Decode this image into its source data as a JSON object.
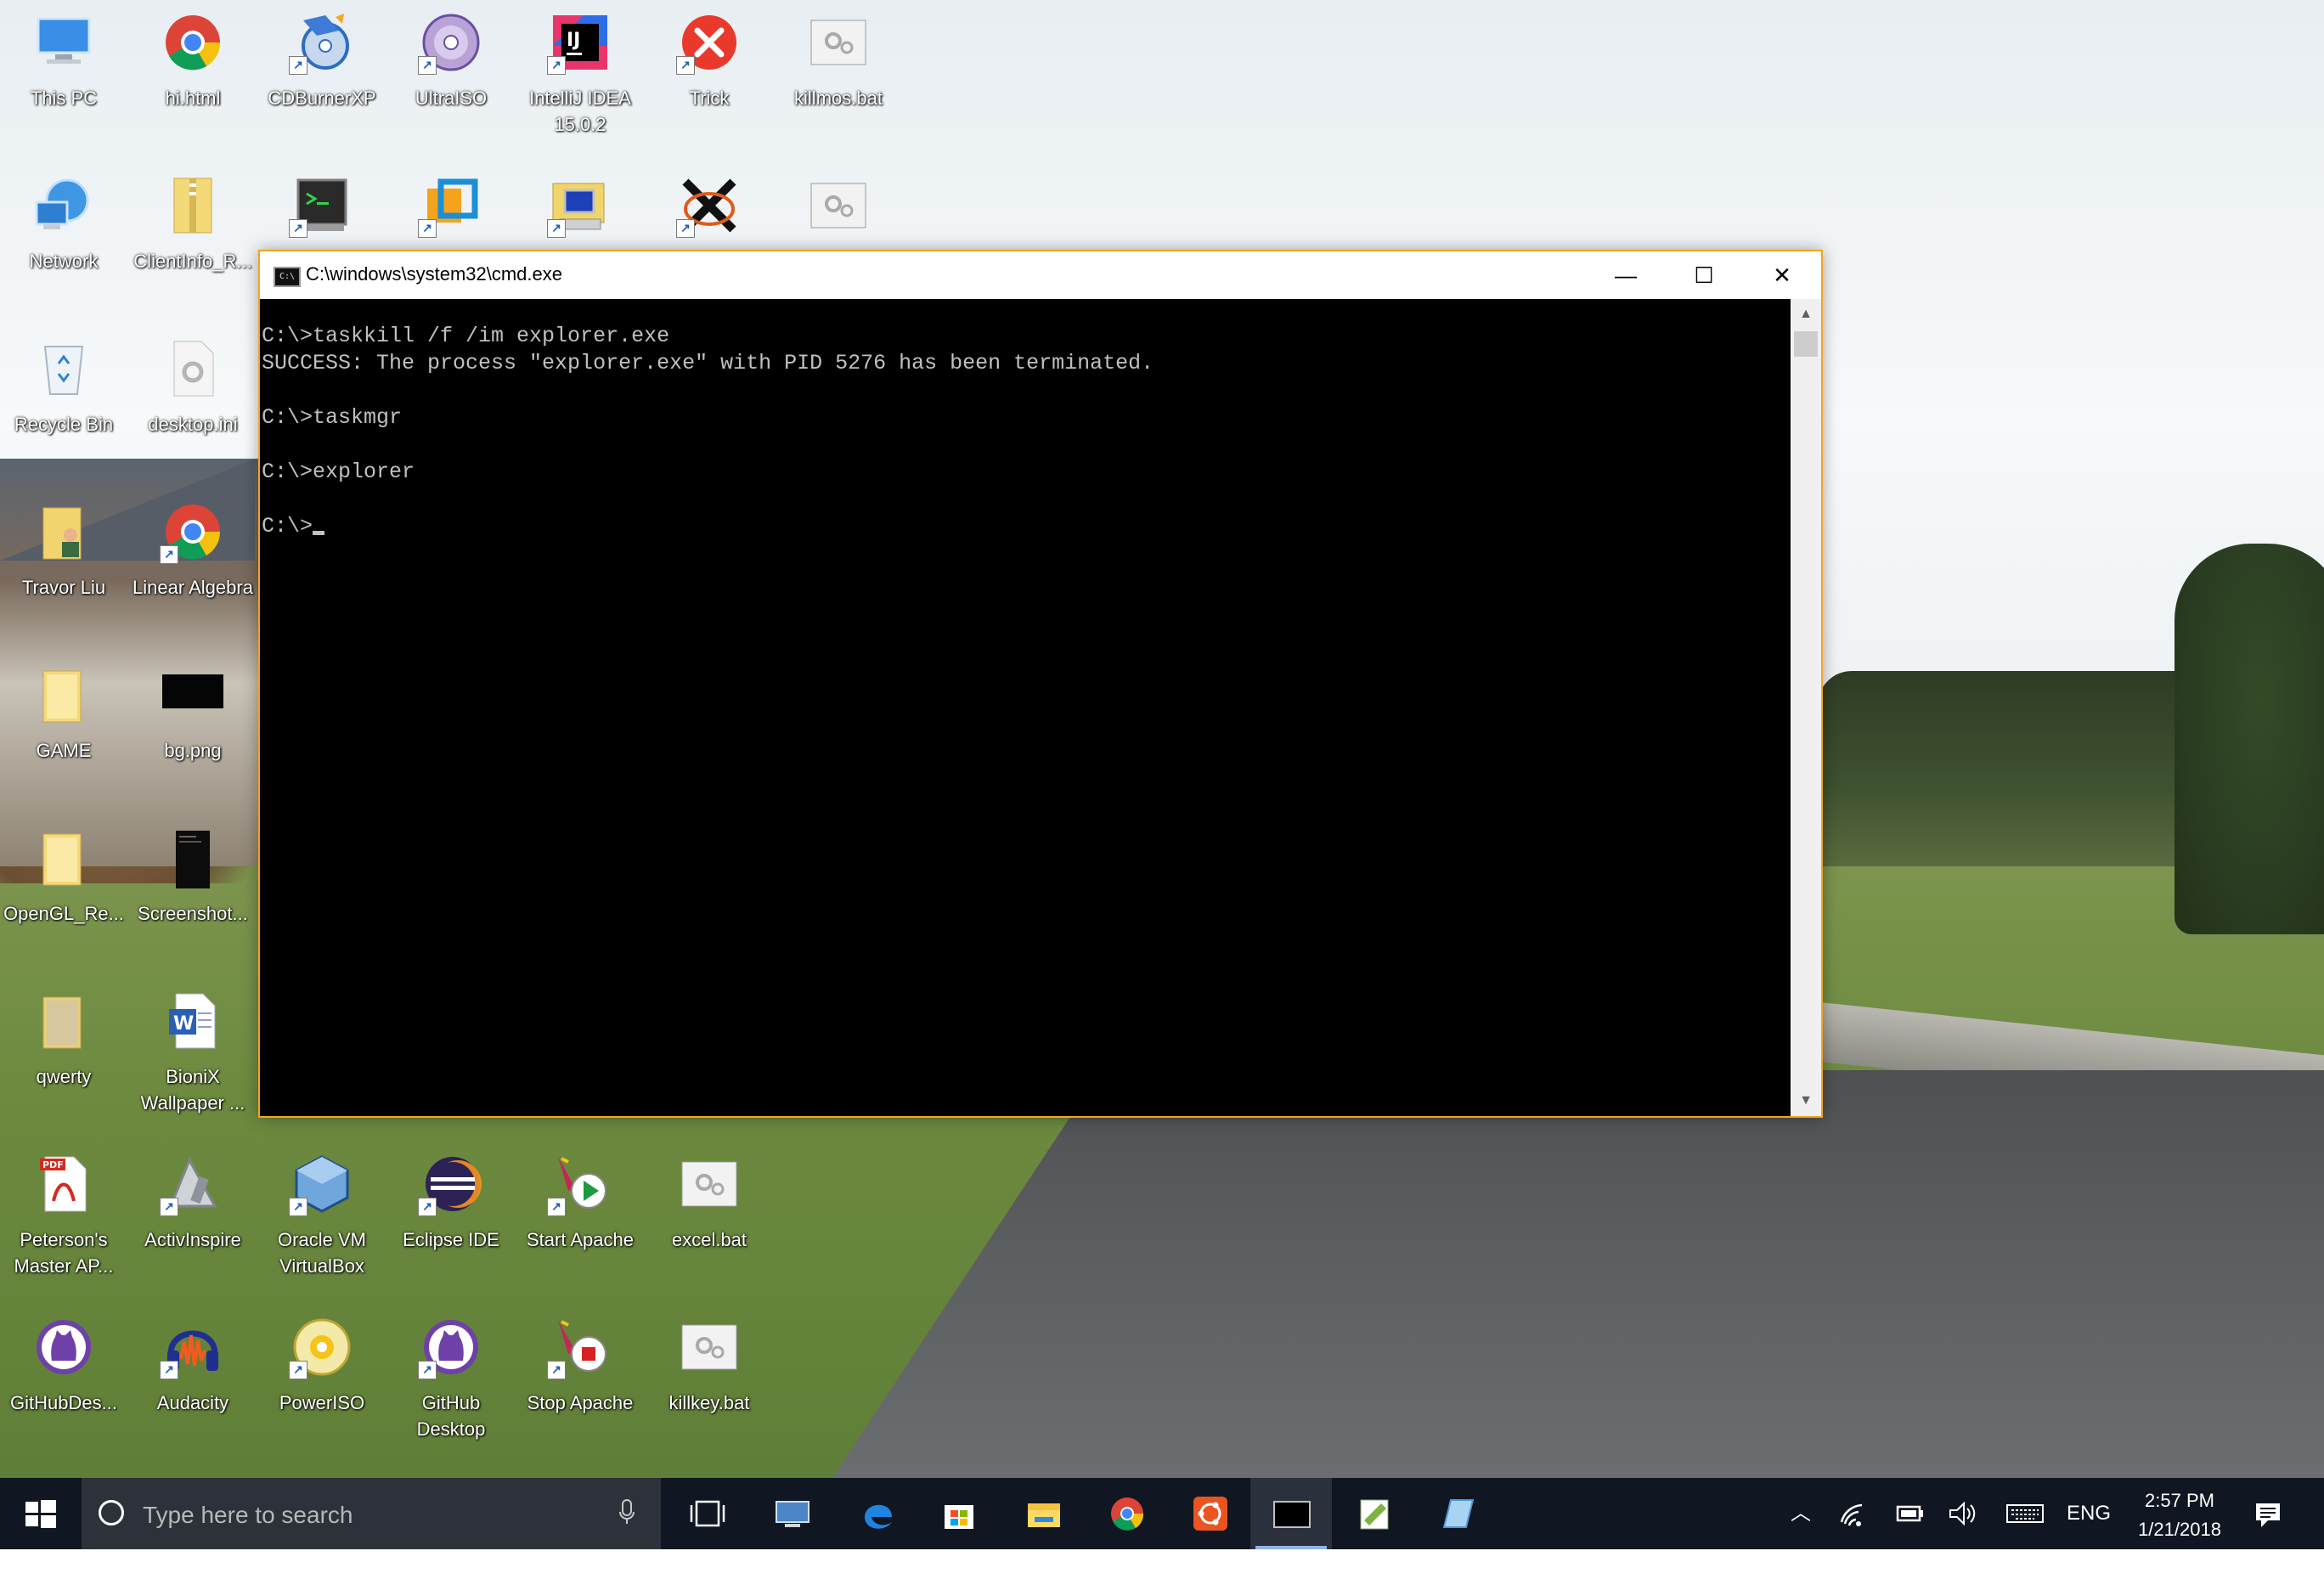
{
  "desktop": {
    "icons": [
      {
        "id": "this-pc",
        "label": "This PC"
      },
      {
        "id": "hi-html",
        "label": "hi.html"
      },
      {
        "id": "cdburnerxp",
        "label": "CDBurnerXP"
      },
      {
        "id": "ultraiso",
        "label": "UltraISO"
      },
      {
        "id": "intellij",
        "label": "IntelliJ IDEA 15.0.2"
      },
      {
        "id": "trick",
        "label": "Trick"
      },
      {
        "id": "killmos",
        "label": "killmos.bat"
      },
      {
        "id": "network",
        "label": "Network"
      },
      {
        "id": "clientinfo",
        "label": "ClientInfo_R..."
      },
      {
        "id": "recycle-bin",
        "label": "Recycle Bin"
      },
      {
        "id": "desktop-ini",
        "label": "desktop.ini"
      },
      {
        "id": "travor-liu",
        "label": "Travor Liu"
      },
      {
        "id": "linear-algebra",
        "label": "Linear Algebra"
      },
      {
        "id": "game",
        "label": "GAME"
      },
      {
        "id": "bg-png",
        "label": "bg.png"
      },
      {
        "id": "opengl",
        "label": "OpenGL_Re..."
      },
      {
        "id": "screenshot",
        "label": "Screenshot..."
      },
      {
        "id": "qwerty",
        "label": "qwerty"
      },
      {
        "id": "bionix",
        "label": "BioniX Wallpaper ..."
      },
      {
        "id": "petersons",
        "label": "Peterson's Master AP..."
      },
      {
        "id": "activinspire",
        "label": "ActivInspire"
      },
      {
        "id": "virtualbox",
        "label": "Oracle VM VirtualBox"
      },
      {
        "id": "eclipse",
        "label": "Eclipse IDE"
      },
      {
        "id": "start-apache",
        "label": "Start Apache"
      },
      {
        "id": "excel-bat",
        "label": "excel.bat"
      },
      {
        "id": "githubdes",
        "label": "GitHubDes..."
      },
      {
        "id": "audacity",
        "label": "Audacity"
      },
      {
        "id": "poweriso",
        "label": "PowerISO"
      },
      {
        "id": "github-desktop",
        "label": "GitHub Desktop"
      },
      {
        "id": "stop-apache",
        "label": "Stop Apache"
      },
      {
        "id": "killkey",
        "label": "killkey.bat"
      }
    ]
  },
  "cmd_window": {
    "title": "C:\\windows\\system32\\cmd.exe",
    "minimize_glyph": "—",
    "maximize_glyph": "☐",
    "close_glyph": "✕",
    "lines": [
      "C:\\>taskkill /f /im explorer.exe",
      "SUCCESS: The process \"explorer.exe\" with PID 5276 has been terminated.",
      "",
      "C:\\>taskmgr",
      "",
      "C:\\>explorer",
      "",
      "C:\\>"
    ],
    "colors": {
      "border": "#f4a41c",
      "console_bg": "#000000",
      "console_fg": "#c0c0c0"
    }
  },
  "taskbar": {
    "search_placeholder": "Type here to search",
    "language": "ENG",
    "time": "2:57 PM",
    "date": "1/21/2018"
  }
}
